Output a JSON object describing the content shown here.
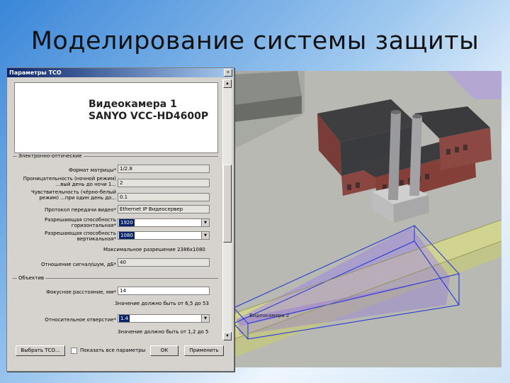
{
  "slide": {
    "title": "Моделирование системы защиты"
  },
  "dialog": {
    "title": "Параметры ТСО",
    "close_glyph": "×",
    "camera_name_line1": "Видеокамера 1",
    "camera_name_line2": "SANYO VCC-HD4600P",
    "section_electro": "Электронно-оптические",
    "rows": [
      {
        "label": "Формат матрицы*",
        "value": "1/2.8",
        "kind": "field"
      },
      {
        "label": "Проницательность (ночной режим) ...вый день до ночи 1...",
        "value": "2",
        "kind": "field"
      },
      {
        "label": "Чувствительность (чёрно-белый режим) ...при один день до...",
        "value": "0.1",
        "kind": "field"
      },
      {
        "label": "Протокол передачи видео*",
        "value": "Ethernet IP Видеосервер",
        "kind": "field"
      },
      {
        "label": "Разрешающая способность горизонтальная*",
        "value": "1920",
        "kind": "combo"
      },
      {
        "label": "Разрешающая способность вертикальная*",
        "value": "1080",
        "kind": "combo"
      }
    ],
    "max_resolution_note": "Максимальное разрешение 2386x1080",
    "snr_label": "Отношение сигнал/шум, дБ*",
    "snr_value": "40",
    "section_lens": "Объектив",
    "focal_label": "Фокусное расстояние, мм*",
    "focal_value": "14",
    "focal_note": "Значение должно быть от 6,5 до 53",
    "aperture_label": "Относительное отверстие*",
    "aperture_value": "1.4",
    "aperture_note": "Значение должно быть от 1,2 до 5",
    "buttons": {
      "select": "Выбрать ТСО...",
      "show_label": "Показать все параметры",
      "ok": "ОК",
      "apply": "Применить"
    }
  },
  "scene": {
    "camera_label": "Видеокамера 2",
    "colors": {
      "ground": "#b8bbb3",
      "road": "#d8dc8a",
      "brick": "#7a3c36",
      "roof": "#3d3d3f",
      "fov": "#a690ee",
      "outline": "#2a3ad6"
    }
  }
}
